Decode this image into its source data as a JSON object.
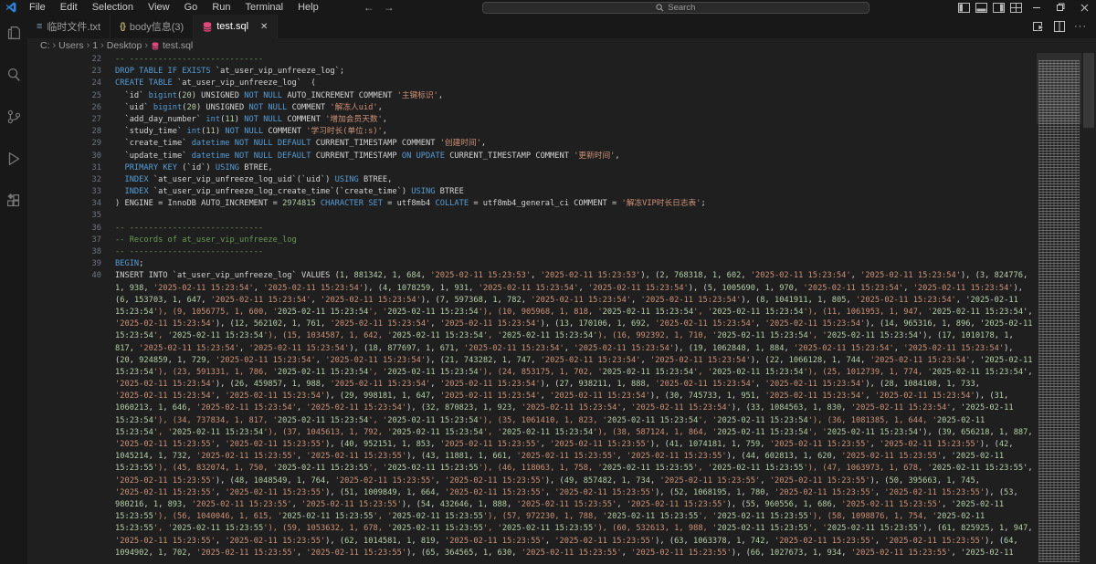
{
  "titlebar": {
    "menus": [
      "File",
      "Edit",
      "Selection",
      "View",
      "Go",
      "Run",
      "Terminal",
      "Help"
    ],
    "back_arrow": "←",
    "forward_arrow": "→",
    "search_placeholder": "Search"
  },
  "tabs": [
    {
      "label": "临时文件.txt",
      "icon": "text-file-icon",
      "active": false
    },
    {
      "label": "body信息(3)",
      "icon": "json-icon",
      "active": false
    },
    {
      "label": "test.sql",
      "icon": "database-icon",
      "active": true,
      "close_glyph": "✕"
    }
  ],
  "breadcrumb": {
    "separator": "›",
    "items": [
      "C:",
      "Users",
      "1",
      "Desktop",
      "test.sql"
    ]
  },
  "glyphs": {
    "json_braces": "{}",
    "txt_lines": "≡",
    "more_actions": "···"
  },
  "colors": {
    "accent_db_icon": "#e0477e",
    "keyword": "#569cd6",
    "string": "#ce9178",
    "number": "#b5cea8",
    "comment": "#6a9955",
    "editor_bg": "#1f1f1f",
    "chrome_bg": "#181818"
  },
  "editor": {
    "language": "sql",
    "lines": [
      {
        "n": "22",
        "t": "-- ----------------------------"
      },
      {
        "n": "23",
        "t": "DROP TABLE IF EXISTS `at_user_vip_unfreeze_log`;"
      },
      {
        "n": "24",
        "t": "CREATE TABLE `at_user_vip_unfreeze_log`  ("
      },
      {
        "n": "25",
        "t": "  `id` bigint(20) UNSIGNED NOT NULL AUTO_INCREMENT COMMENT '主键标识',"
      },
      {
        "n": "26",
        "t": "  `uid` bigint(20) UNSIGNED NOT NULL COMMENT '解冻人uid',"
      },
      {
        "n": "27",
        "t": "  `add_day_number` int(11) NOT NULL COMMENT '增加会员天数',"
      },
      {
        "n": "28",
        "t": "  `study_time` int(11) NOT NULL COMMENT '学习时长(单位:s)',"
      },
      {
        "n": "29",
        "t": "  `create_time` datetime NOT NULL DEFAULT CURRENT_TIMESTAMP COMMENT '创建时间',"
      },
      {
        "n": "30",
        "t": "  `update_time` datetime NOT NULL DEFAULT CURRENT_TIMESTAMP ON UPDATE CURRENT_TIMESTAMP COMMENT '更新时间',"
      },
      {
        "n": "31",
        "t": "  PRIMARY KEY (`id`) USING BTREE,"
      },
      {
        "n": "32",
        "t": "  INDEX `at_user_vip_unfreeze_log_uid`(`uid`) USING BTREE,"
      },
      {
        "n": "33",
        "t": "  INDEX `at_user_vip_unfreeze_log_create_time`(`create_time`) USING BTREE"
      },
      {
        "n": "34",
        "t": ") ENGINE = InnoDB AUTO_INCREMENT = 2974815 CHARACTER SET = utf8mb4 COLLATE = utf8mb4_general_ci COMMENT = '解冻VIP时长日志表';"
      },
      {
        "n": "35",
        "t": ""
      },
      {
        "n": "36",
        "t": "-- ----------------------------"
      },
      {
        "n": "37",
        "t": "-- Records of at_user_vip_unfreeze_log"
      },
      {
        "n": "38",
        "t": "-- ----------------------------"
      },
      {
        "n": "39",
        "t": "BEGIN;"
      },
      {
        "n": "40",
        "t": "INSERT INTO `at_user_vip_unfreeze_log` VALUES (1, 881342, 1, 684, '2025-02-11 15:23:53', '2025-02-11 15:23:53'), (2, 768318, 1, 602, '2025-02-11 15:23:54', '2025-02-11 15:23:54'), (3, 824776,"
      },
      {
        "n": "",
        "t": "1, 938, '2025-02-11 15:23:54', '2025-02-11 15:23:54'), (4, 1078259, 1, 931, '2025-02-11 15:23:54', '2025-02-11 15:23:54'), (5, 1005690, 1, 970, '2025-02-11 15:23:54', '2025-02-11 15:23:54'),"
      },
      {
        "n": "",
        "t": "(6, 153703, 1, 647, '2025-02-11 15:23:54', '2025-02-11 15:23:54'), (7, 597368, 1, 782, '2025-02-11 15:23:54', '2025-02-11 15:23:54'), (8, 1041911, 1, 805, '2025-02-11 15:23:54', '2025-02-11"
      },
      {
        "n": "",
        "t": "15:23:54'), (9, 1056775, 1, 600, '2025-02-11 15:23:54', '2025-02-11 15:23:54'), (10, 905968, 1, 818, '2025-02-11 15:23:54', '2025-02-11 15:23:54'), (11, 1061953, 1, 947, '2025-02-11 15:23:54',"
      },
      {
        "n": "",
        "t": "'2025-02-11 15:23:54'), (12, 562102, 1, 761, '2025-02-11 15:23:54', '2025-02-11 15:23:54'), (13, 170106, 1, 692, '2025-02-11 15:23:54', '2025-02-11 15:23:54'), (14, 965316, 1, 896, '2025-02-11"
      },
      {
        "n": "",
        "t": "15:23:54', '2025-02-11 15:23:54'), (15, 1034587, 1, 642, '2025-02-11 15:23:54', '2025-02-11 15:23:54'), (16, 992392, 1, 710, '2025-02-11 15:23:54', '2025-02-11 15:23:54'), (17, 1010178, 1,"
      },
      {
        "n": "",
        "t": "817, '2025-02-11 15:23:54', '2025-02-11 15:23:54'), (18, 877697, 1, 671, '2025-02-11 15:23:54', '2025-02-11 15:23:54'), (19, 1062848, 1, 884, '2025-02-11 15:23:54', '2025-02-11 15:23:54'),"
      },
      {
        "n": "",
        "t": "(20, 924859, 1, 729, '2025-02-11 15:23:54', '2025-02-11 15:23:54'), (21, 743282, 1, 747, '2025-02-11 15:23:54', '2025-02-11 15:23:54'), (22, 1066128, 1, 744, '2025-02-11 15:23:54', '2025-02-11"
      },
      {
        "n": "",
        "t": "15:23:54'), (23, 591331, 1, 786, '2025-02-11 15:23:54', '2025-02-11 15:23:54'), (24, 853175, 1, 702, '2025-02-11 15:23:54', '2025-02-11 15:23:54'), (25, 1012739, 1, 774, '2025-02-11 15:23:54',"
      },
      {
        "n": "",
        "t": "'2025-02-11 15:23:54'), (26, 459857, 1, 988, '2025-02-11 15:23:54', '2025-02-11 15:23:54'), (27, 938211, 1, 888, '2025-02-11 15:23:54', '2025-02-11 15:23:54'), (28, 1084108, 1, 733,"
      },
      {
        "n": "",
        "t": "'2025-02-11 15:23:54', '2025-02-11 15:23:54'), (29, 998181, 1, 647, '2025-02-11 15:23:54', '2025-02-11 15:23:54'), (30, 745733, 1, 951, '2025-02-11 15:23:54', '2025-02-11 15:23:54'), (31,"
      },
      {
        "n": "",
        "t": "1060213, 1, 646, '2025-02-11 15:23:54', '2025-02-11 15:23:54'), (32, 870823, 1, 923, '2025-02-11 15:23:54', '2025-02-11 15:23:54'), (33, 1084563, 1, 830, '2025-02-11 15:23:54', '2025-02-11"
      },
      {
        "n": "",
        "t": "15:23:54'), (34, 737834, 1, 817, '2025-02-11 15:23:54', '2025-02-11 15:23:54'), (35, 1061410, 1, 823, '2025-02-11 15:23:54', '2025-02-11 15:23:54'), (36, 1081385, 1, 644, '2025-02-11"
      },
      {
        "n": "",
        "t": "15:23:54', '2025-02-11 15:23:54'), (37, 1045613, 1, 792, '2025-02-11 15:23:54', '2025-02-11 15:23:54'), (38, 587124, 1, 864, '2025-02-11 15:23:54', '2025-02-11 15:23:54'), (39, 656218, 1, 887,"
      },
      {
        "n": "",
        "t": "'2025-02-11 15:23:55', '2025-02-11 15:23:55'), (40, 952151, 1, 853, '2025-02-11 15:23:55', '2025-02-11 15:23:55'), (41, 1074181, 1, 759, '2025-02-11 15:23:55', '2025-02-11 15:23:55'), (42,"
      },
      {
        "n": "",
        "t": "1045214, 1, 732, '2025-02-11 15:23:55', '2025-02-11 15:23:55'), (43, 11881, 1, 661, '2025-02-11 15:23:55', '2025-02-11 15:23:55'), (44, 602813, 1, 620, '2025-02-11 15:23:55', '2025-02-11"
      },
      {
        "n": "",
        "t": "15:23:55'), (45, 832074, 1, 750, '2025-02-11 15:23:55', '2025-02-11 15:23:55'), (46, 118063, 1, 758, '2025-02-11 15:23:55', '2025-02-11 15:23:55'), (47, 1063973, 1, 678, '2025-02-11 15:23:55',"
      },
      {
        "n": "",
        "t": "'2025-02-11 15:23:55'), (48, 1048549, 1, 764, '2025-02-11 15:23:55', '2025-02-11 15:23:55'), (49, 857482, 1, 734, '2025-02-11 15:23:55', '2025-02-11 15:23:55'), (50, 395663, 1, 745,"
      },
      {
        "n": "",
        "t": "'2025-02-11 15:23:55', '2025-02-11 15:23:55'), (51, 1009849, 1, 664, '2025-02-11 15:23:55', '2025-02-11 15:23:55'), (52, 1068195, 1, 780, '2025-02-11 15:23:55', '2025-02-11 15:23:55'), (53,"
      },
      {
        "n": "",
        "t": "980216, 1, 893, '2025-02-11 15:23:55', '2025-02-11 15:23:55'), (54, 432646, 1, 888, '2025-02-11 15:23:55', '2025-02-11 15:23:55'), (55, 960556, 1, 686, '2025-02-11 15:23:55', '2025-02-11"
      },
      {
        "n": "",
        "t": "15:23:55'), (56, 1040046, 1, 615, '2025-02-11 15:23:55', '2025-02-11 15:23:55'), (57, 972230, 1, 788, '2025-02-11 15:23:55', '2025-02-11 15:23:55'), (58, 1098876, 1, 754, '2025-02-11"
      },
      {
        "n": "",
        "t": "15:23:55', '2025-02-11 15:23:55'), (59, 1053632, 1, 678, '2025-02-11 15:23:55', '2025-02-11 15:23:55'), (60, 532613, 1, 988, '2025-02-11 15:23:55', '2025-02-11 15:23:55'), (61, 825925, 1, 947,"
      },
      {
        "n": "",
        "t": "'2025-02-11 15:23:55', '2025-02-11 15:23:55'), (62, 1014581, 1, 819, '2025-02-11 15:23:55', '2025-02-11 15:23:55'), (63, 1063378, 1, 742, '2025-02-11 15:23:55', '2025-02-11 15:23:55'), (64,"
      },
      {
        "n": "",
        "t": "1094902, 1, 702, '2025-02-11 15:23:55', '2025-02-11 15:23:55'), (65, 364565, 1, 630, '2025-02-11 15:23:55', '2025-02-11 15:23:55'), (66, 1027673, 1, 934, '2025-02-11 15:23:55', '2025-02-11"
      }
    ],
    "syntax": {
      "keywords": [
        "DROP",
        "TABLE",
        "IF",
        "EXISTS",
        "CREATE",
        "NOT",
        "NULL",
        "DEFAULT",
        "ON",
        "UPDATE",
        "PRIMARY",
        "KEY",
        "USING",
        "INDEX",
        "CHARACTER",
        "SET",
        "COLLATE",
        "BEGIN",
        "bigint",
        "int",
        "datetime"
      ]
    }
  }
}
